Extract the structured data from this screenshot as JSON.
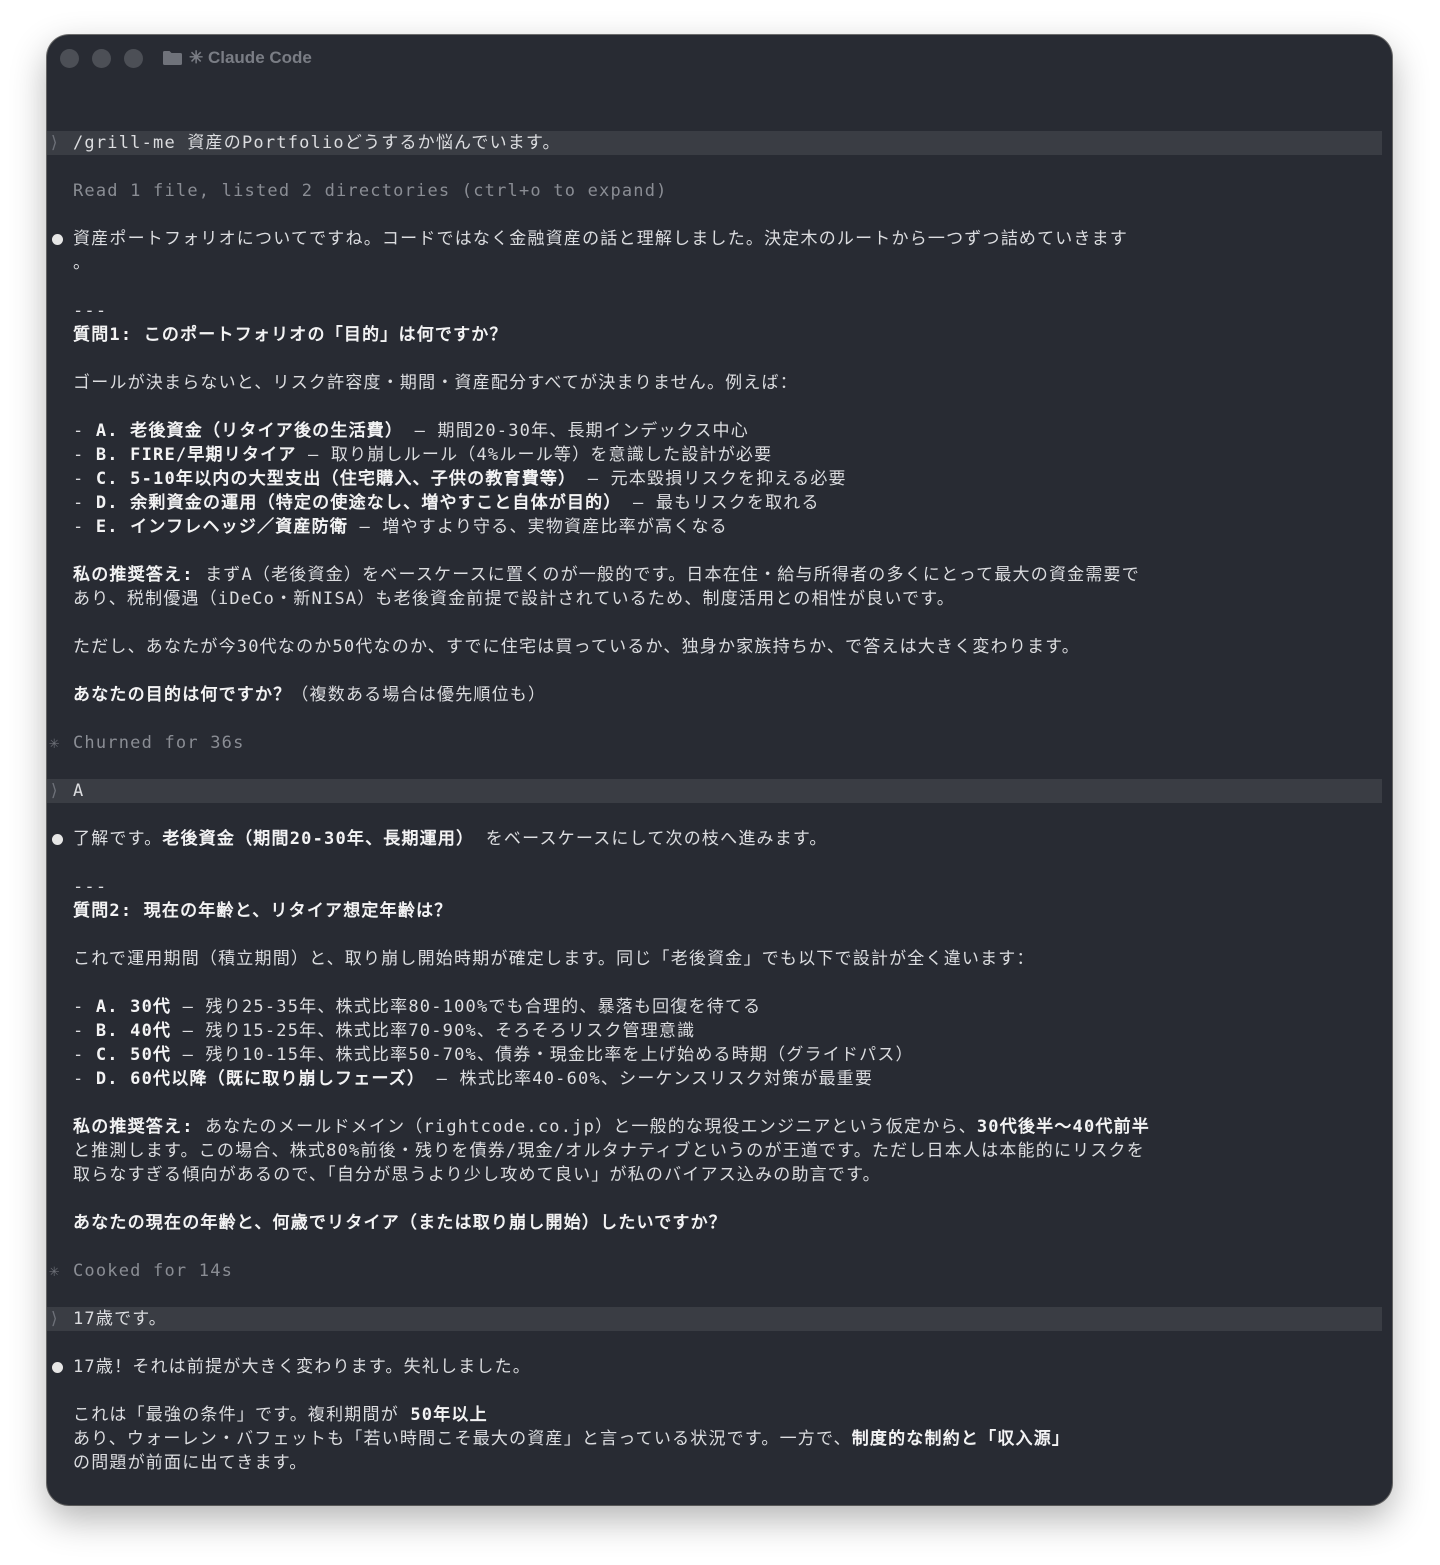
{
  "window": {
    "title": "✳ Claude Code",
    "icons": [
      "close-light",
      "minimize-light",
      "zoom-light",
      "folder-icon"
    ]
  },
  "terminal": {
    "prompt_symbol": "⟩",
    "spinner_symbol": "✳",
    "lines": [
      {
        "k": "blank"
      },
      {
        "k": "prompt",
        "segs": [
          {
            "t": "/grill-me 資産のPortfolioどうするか悩んでいます。"
          }
        ]
      },
      {
        "k": "blank"
      },
      {
        "k": "dim",
        "segs": [
          {
            "t": "Read 1 file, listed 2 directories (ctrl+o to expand)"
          }
        ]
      },
      {
        "k": "blank"
      },
      {
        "k": "bullet",
        "segs": [
          {
            "t": "資産ポートフォリオについてですね。コードではなく金融資産の話と理解しました。決定木のルートから一つずつ詰めていきます"
          }
        ]
      },
      {
        "k": "text",
        "segs": [
          {
            "t": "。"
          }
        ]
      },
      {
        "k": "blank"
      },
      {
        "k": "text",
        "segs": [
          {
            "t": "---"
          }
        ]
      },
      {
        "k": "text",
        "segs": [
          {
            "t": "質問1: このポートフォリオの「目的」は何ですか？",
            "b": true
          }
        ]
      },
      {
        "k": "blank"
      },
      {
        "k": "text",
        "segs": [
          {
            "t": "ゴールが決まらないと、リスク許容度・期間・資産配分すべてが決まりません。例えば："
          }
        ]
      },
      {
        "k": "blank"
      },
      {
        "k": "text",
        "segs": [
          {
            "t": "- "
          },
          {
            "t": "A. 老後資金（リタイア後の生活費）",
            "b": true
          },
          {
            "t": " — 期間20-30年、長期インデックス中心"
          }
        ]
      },
      {
        "k": "text",
        "segs": [
          {
            "t": "- "
          },
          {
            "t": "B. FIRE/早期リタイア",
            "b": true
          },
          {
            "t": " — 取り崩しルール（4%ルール等）を意識した設計が必要"
          }
        ]
      },
      {
        "k": "text",
        "segs": [
          {
            "t": "- "
          },
          {
            "t": "C. 5-10年以内の大型支出（住宅購入、子供の教育費等）",
            "b": true
          },
          {
            "t": " — 元本毀損リスクを抑える必要"
          }
        ]
      },
      {
        "k": "text",
        "segs": [
          {
            "t": "- "
          },
          {
            "t": "D. 余剰資金の運用（特定の使途なし、増やすこと自体が目的）",
            "b": true
          },
          {
            "t": " — 最もリスクを取れる"
          }
        ]
      },
      {
        "k": "text",
        "segs": [
          {
            "t": "- "
          },
          {
            "t": "E. インフレヘッジ／資産防衛",
            "b": true
          },
          {
            "t": " — 増やすより守る、実物資産比率が高くなる"
          }
        ]
      },
      {
        "k": "blank"
      },
      {
        "k": "text",
        "segs": [
          {
            "t": "私の推奨答え:",
            "b": true
          },
          {
            "t": " まずA（老後資金）をベースケースに置くのが一般的です。日本在住・給与所得者の多くにとって最大の資金需要で"
          }
        ]
      },
      {
        "k": "text",
        "segs": [
          {
            "t": "あり、税制優遇（iDeCo・新NISA）も老後資金前提で設計されているため、制度活用との相性が良いです。"
          }
        ]
      },
      {
        "k": "blank"
      },
      {
        "k": "text",
        "segs": [
          {
            "t": "ただし、あなたが今30代なのか50代なのか、すでに住宅は買っているか、独身か家族持ちか、で答えは大きく変わります。"
          }
        ]
      },
      {
        "k": "blank"
      },
      {
        "k": "text",
        "segs": [
          {
            "t": "あなたの目的は何ですか？",
            "b": true
          },
          {
            "t": "（複数ある場合は優先順位も）"
          }
        ]
      },
      {
        "k": "blank"
      },
      {
        "k": "status",
        "segs": [
          {
            "t": "Churned for 36s"
          }
        ]
      },
      {
        "k": "blank"
      },
      {
        "k": "prompt",
        "segs": [
          {
            "t": "A"
          }
        ]
      },
      {
        "k": "blank"
      },
      {
        "k": "bullet",
        "segs": [
          {
            "t": "了解です。"
          },
          {
            "t": "老後資金（期間20-30年、長期運用）",
            "b": true
          },
          {
            "t": " をベースケースにして次の枝へ進みます。"
          }
        ]
      },
      {
        "k": "blank"
      },
      {
        "k": "text",
        "segs": [
          {
            "t": "---"
          }
        ]
      },
      {
        "k": "text",
        "segs": [
          {
            "t": "質問2: 現在の年齢と、リタイア想定年齢は？",
            "b": true
          }
        ]
      },
      {
        "k": "blank"
      },
      {
        "k": "text",
        "segs": [
          {
            "t": "これで運用期間（積立期間）と、取り崩し開始時期が確定します。同じ「老後資金」でも以下で設計が全く違います："
          }
        ]
      },
      {
        "k": "blank"
      },
      {
        "k": "text",
        "segs": [
          {
            "t": "- "
          },
          {
            "t": "A. 30代",
            "b": true
          },
          {
            "t": " — 残り25-35年、株式比率80-100%でも合理的、暴落も回復を待てる"
          }
        ]
      },
      {
        "k": "text",
        "segs": [
          {
            "t": "- "
          },
          {
            "t": "B. 40代",
            "b": true
          },
          {
            "t": " — 残り15-25年、株式比率70-90%、そろそろリスク管理意識"
          }
        ]
      },
      {
        "k": "text",
        "segs": [
          {
            "t": "- "
          },
          {
            "t": "C. 50代",
            "b": true
          },
          {
            "t": " — 残り10-15年、株式比率50-70%、債券・現金比率を上げ始める時期（グライドパス）"
          }
        ]
      },
      {
        "k": "text",
        "segs": [
          {
            "t": "- "
          },
          {
            "t": "D. 60代以降（既に取り崩しフェーズ）",
            "b": true
          },
          {
            "t": " — 株式比率40-60%、シーケンスリスク対策が最重要"
          }
        ]
      },
      {
        "k": "blank"
      },
      {
        "k": "text",
        "segs": [
          {
            "t": "私の推奨答え:",
            "b": true
          },
          {
            "t": " あなたのメールドメイン（rightcode.co.jp）と一般的な現役エンジニアという仮定から、"
          },
          {
            "t": "30代後半〜40代前半",
            "b": true
          }
        ]
      },
      {
        "k": "text",
        "segs": [
          {
            "t": "と推測します。この場合、株式80%前後・残りを債券/現金/オルタナティブというのが王道です。ただし日本人は本能的にリスクを"
          }
        ]
      },
      {
        "k": "text",
        "segs": [
          {
            "t": "取らなすぎる傾向があるので、「自分が思うより少し攻めて良い」が私のバイアス込みの助言です。"
          }
        ]
      },
      {
        "k": "blank"
      },
      {
        "k": "text",
        "segs": [
          {
            "t": "あなたの現在の年齢と、何歳でリタイア（または取り崩し開始）したいですか？",
            "b": true
          }
        ]
      },
      {
        "k": "blank"
      },
      {
        "k": "status",
        "segs": [
          {
            "t": "Cooked for 14s"
          }
        ]
      },
      {
        "k": "blank"
      },
      {
        "k": "prompt",
        "segs": [
          {
            "t": "17歳です。"
          }
        ]
      },
      {
        "k": "blank"
      },
      {
        "k": "bullet",
        "segs": [
          {
            "t": "17歳！それは前提が大きく変わります。失礼しました。"
          }
        ]
      },
      {
        "k": "blank"
      },
      {
        "k": "text",
        "segs": [
          {
            "t": "これは「最強の条件」です。複利期間が "
          },
          {
            "t": "50年以上",
            "b": true
          }
        ]
      },
      {
        "k": "text",
        "segs": [
          {
            "t": "あり、ウォーレン・バフェットも「若い時間こそ最大の資産」と言っている状況です。一方で、"
          },
          {
            "t": "制度的な制約と「収入源」",
            "b": true
          }
        ]
      },
      {
        "k": "text",
        "segs": [
          {
            "t": "の問題が前面に出てきます。"
          }
        ]
      },
      {
        "k": "blank"
      },
      {
        "k": "text",
        "segs": [
          {
            "t": "---"
          }
        ]
      }
    ]
  }
}
